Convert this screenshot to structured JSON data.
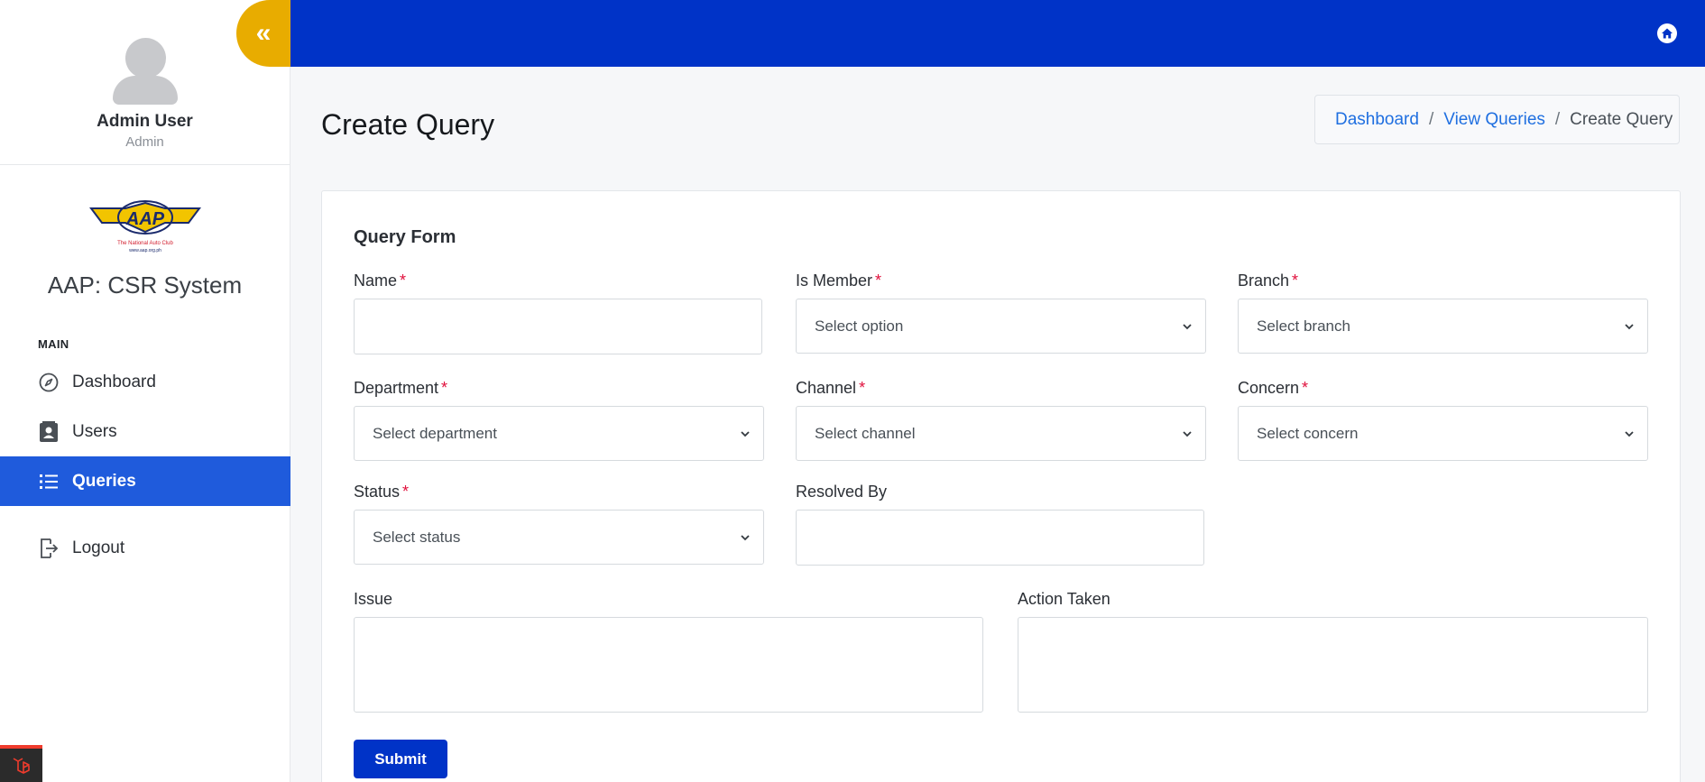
{
  "user": {
    "name": "Admin User",
    "role": "Admin"
  },
  "brand": {
    "title": "AAP: CSR System",
    "logo_text": "AAP",
    "logo_tagline": "The National Auto Club",
    "logo_url": "www.aap.org.ph"
  },
  "sidebar": {
    "section_label": "MAIN",
    "items": [
      {
        "label": "Dashboard",
        "icon": "compass-icon"
      },
      {
        "label": "Users",
        "icon": "contact-card-icon"
      },
      {
        "label": "Queries",
        "icon": "list-icon",
        "active": true
      },
      {
        "label": "Logout",
        "icon": "logout-icon"
      }
    ],
    "collapse_icon": "«"
  },
  "page": {
    "title": "Create Query"
  },
  "breadcrumb": {
    "items": [
      "Dashboard",
      "View Queries"
    ],
    "current": "Create Query"
  },
  "form": {
    "title": "Query Form",
    "required_marker": "*",
    "fields": {
      "name": {
        "label": "Name",
        "value": ""
      },
      "is_member": {
        "label": "Is Member",
        "placeholder": "Select option"
      },
      "branch": {
        "label": "Branch",
        "placeholder": "Select branch"
      },
      "department": {
        "label": "Department",
        "placeholder": "Select department"
      },
      "channel": {
        "label": "Channel",
        "placeholder": "Select channel"
      },
      "concern": {
        "label": "Concern",
        "placeholder": "Select concern"
      },
      "status": {
        "label": "Status",
        "placeholder": "Select status"
      },
      "resolved_by": {
        "label": "Resolved By",
        "value": ""
      },
      "issue": {
        "label": "Issue",
        "value": ""
      },
      "action_taken": {
        "label": "Action Taken",
        "value": ""
      }
    },
    "submit_label": "Submit"
  },
  "colors": {
    "topbar": "#0033c7",
    "active_nav": "#1f5bdc",
    "collapse_button": "#e8ac00",
    "link": "#1f6fe0",
    "required": "#e0103c"
  }
}
